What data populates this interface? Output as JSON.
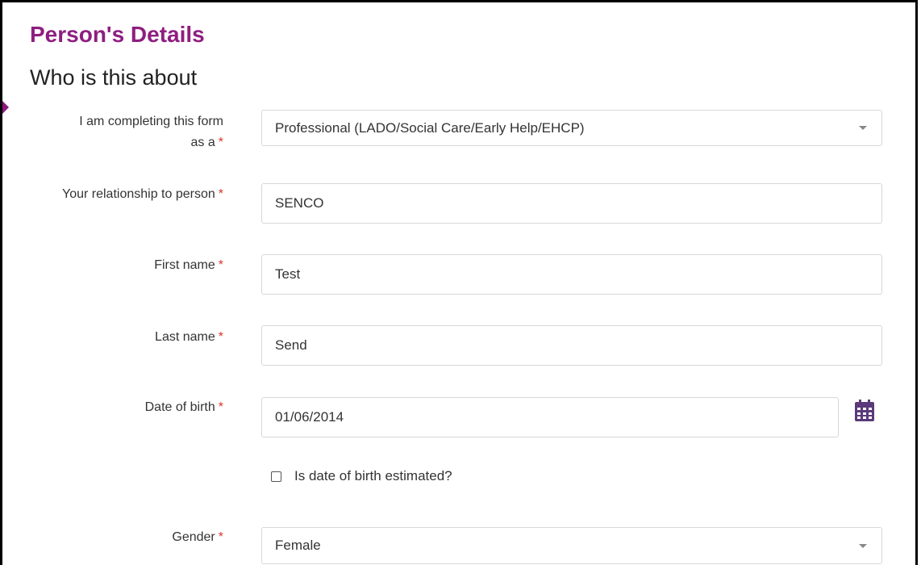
{
  "section_title": "Person's Details",
  "subsection_title": "Who is this about",
  "required_marker": "*",
  "fields": {
    "completing_as": {
      "label_line1": "I am completing this form",
      "label_line2": "as a",
      "value": "Professional (LADO/Social Care/Early Help/EHCP)"
    },
    "relationship": {
      "label": "Your relationship to person",
      "value": "SENCO"
    },
    "first_name": {
      "label": "First name",
      "value": "Test"
    },
    "last_name": {
      "label": "Last name",
      "value": "Send"
    },
    "date_of_birth": {
      "label": "Date of birth",
      "value": "01/06/2014"
    },
    "dob_estimated": {
      "label": "Is date of birth estimated?",
      "checked": false
    },
    "gender": {
      "label": "Gender",
      "value": "Female"
    }
  },
  "colors": {
    "heading": "#8e1e80",
    "required": "#d9342b",
    "calendar_icon": "#5b3a7a"
  },
  "icons": {
    "calendar": "calendar-icon",
    "dropdown": "chevron-down-icon"
  }
}
